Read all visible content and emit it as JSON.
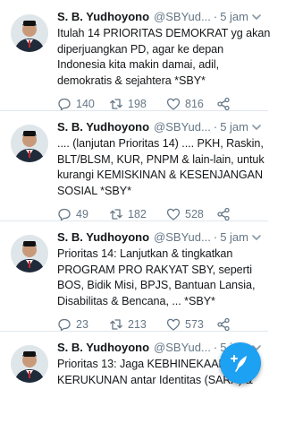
{
  "colors": {
    "accent": "#1da1f2",
    "muted": "#657786",
    "text": "#14171a",
    "divider": "#e1e8ed"
  },
  "tweets": [
    {
      "name": "S. B. Yudhoyono",
      "handle": "@SBYud...",
      "time": "5 jam",
      "lines": [
        "Itulah 14 PRIORITAS DEMOKRAT yg akan",
        "diperjuangkan PD, agar ke depan",
        "Indonesia kita makin damai, adil,",
        "demokratis & sejahtera *SBY*"
      ],
      "replies": "140",
      "retweets": "198",
      "likes": "816"
    },
    {
      "name": "S. B. Yudhoyono",
      "handle": "@SBYud...",
      "time": "5 jam",
      "lines": [
        ".... (lanjutan Prioritas 14) .... PKH, Raskin,",
        "BLT/BLSM, KUR, PNPM & lain-lain, untuk",
        "kurangi KEMISKINAN & KESENJANGAN",
        "SOSIAL *SBY*"
      ],
      "replies": "49",
      "retweets": "182",
      "likes": "528"
    },
    {
      "name": "S. B. Yudhoyono",
      "handle": "@SBYud...",
      "time": "5 jam",
      "lines": [
        "Prioritas 14: Lanjutkan & tingkatkan",
        "PROGRAM PRO RAKYAT SBY, seperti",
        "BOS, Bidik Misi, BPJS, Bantuan Lansia,",
        "Disabilitas & Bencana, ... *SBY*"
      ],
      "replies": "23",
      "retweets": "213",
      "likes": "573"
    },
    {
      "name": "S. B. Yudhoyono",
      "handle": "@SBYud...",
      "time": "5 jam",
      "lines": [
        "Prioritas 13: Jaga KEBHINEKAAN &",
        "KERUKUNAN antar Identitas (SARA) &"
      ],
      "replies": "",
      "retweets": "",
      "likes": ""
    }
  ],
  "icons": {
    "reply": "reply-icon",
    "retweet": "retweet-icon",
    "like": "heart-icon",
    "share": "share-icon",
    "more": "chevron-down-icon",
    "compose": "compose-tweet-icon"
  }
}
